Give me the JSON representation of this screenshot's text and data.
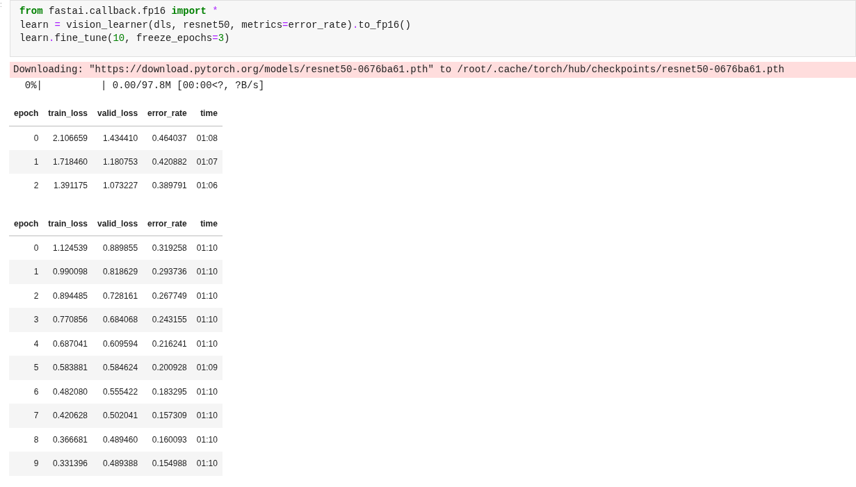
{
  "prompt": ":",
  "code_cell": {
    "lines": [
      [
        {
          "kind": "kw",
          "text": "from"
        },
        {
          "kind": "plain",
          "text": " fastai.callback.fp16 "
        },
        {
          "kind": "kw",
          "text": "import"
        },
        {
          "kind": "op",
          "text": " *"
        }
      ],
      [
        {
          "kind": "plain",
          "text": "learn "
        },
        {
          "kind": "op",
          "text": "="
        },
        {
          "kind": "plain",
          "text": " vision_learner(dls, resnet50, metrics"
        },
        {
          "kind": "op",
          "text": "="
        },
        {
          "kind": "plain",
          "text": "error_rate)"
        },
        {
          "kind": "op",
          "text": "."
        },
        {
          "kind": "plain",
          "text": "to_fp16()"
        }
      ],
      [
        {
          "kind": "plain",
          "text": "learn"
        },
        {
          "kind": "op",
          "text": "."
        },
        {
          "kind": "plain",
          "text": "fine_tune("
        },
        {
          "kind": "num",
          "text": "10"
        },
        {
          "kind": "plain",
          "text": ", freeze_epochs"
        },
        {
          "kind": "op",
          "text": "="
        },
        {
          "kind": "num",
          "text": "3"
        },
        {
          "kind": "plain",
          "text": ")"
        }
      ]
    ]
  },
  "stderr": "Downloading: \"https://download.pytorch.org/models/resnet50-0676ba61.pth\" to /root/.cache/torch/hub/checkpoints/resnet50-0676ba61.pth",
  "progress": "  0%|          | 0.00/97.8M [00:00<?, ?B/s]",
  "tables": [
    {
      "columns": [
        "epoch",
        "train_loss",
        "valid_loss",
        "error_rate",
        "time"
      ],
      "rows": [
        [
          "0",
          "2.106659",
          "1.434410",
          "0.464037",
          "01:08"
        ],
        [
          "1",
          "1.718460",
          "1.180753",
          "0.420882",
          "01:07"
        ],
        [
          "2",
          "1.391175",
          "1.073227",
          "0.389791",
          "01:06"
        ]
      ]
    },
    {
      "columns": [
        "epoch",
        "train_loss",
        "valid_loss",
        "error_rate",
        "time"
      ],
      "rows": [
        [
          "0",
          "1.124539",
          "0.889855",
          "0.319258",
          "01:10"
        ],
        [
          "1",
          "0.990098",
          "0.818629",
          "0.293736",
          "01:10"
        ],
        [
          "2",
          "0.894485",
          "0.728161",
          "0.267749",
          "01:10"
        ],
        [
          "3",
          "0.770856",
          "0.684068",
          "0.243155",
          "01:10"
        ],
        [
          "4",
          "0.687041",
          "0.609594",
          "0.216241",
          "01:10"
        ],
        [
          "5",
          "0.583881",
          "0.584624",
          "0.200928",
          "01:09"
        ],
        [
          "6",
          "0.482080",
          "0.555422",
          "0.183295",
          "01:10"
        ],
        [
          "7",
          "0.420628",
          "0.502041",
          "0.157309",
          "01:10"
        ],
        [
          "8",
          "0.366681",
          "0.489460",
          "0.160093",
          "01:10"
        ],
        [
          "9",
          "0.331396",
          "0.489388",
          "0.154988",
          "01:10"
        ]
      ]
    }
  ]
}
